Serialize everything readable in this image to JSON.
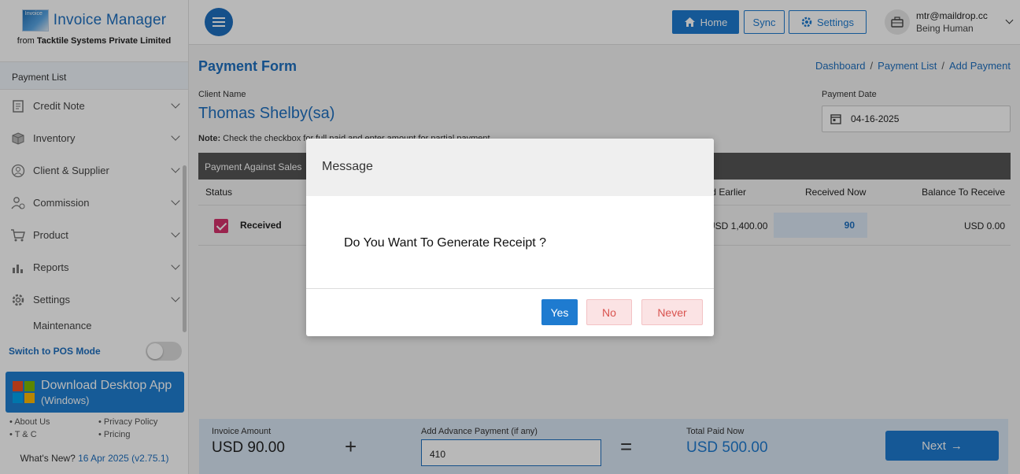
{
  "brand": {
    "logo_text": "Invoice",
    "title": "Invoice Manager",
    "subtitle_prefix": "from ",
    "subtitle_company": "Tacktile Systems Private Limited"
  },
  "sidebar": {
    "active_link": "Payment List",
    "items": [
      {
        "label": "Credit Note",
        "icon": "credit-note-icon"
      },
      {
        "label": "Inventory",
        "icon": "box-icon"
      },
      {
        "label": "Client & Supplier",
        "icon": "user-icon"
      },
      {
        "label": "Commission",
        "icon": "users-icon"
      },
      {
        "label": "Product",
        "icon": "cart-icon"
      },
      {
        "label": "Reports",
        "icon": "report-icon"
      },
      {
        "label": "Settings",
        "icon": "gear-icon"
      },
      {
        "label": "Maintenance",
        "icon": "wrench-icon"
      }
    ],
    "pos_mode_label": "Switch to POS Mode",
    "pos_mode_enabled": false,
    "download": {
      "title": "Download Desktop App",
      "subtitle": "(Windows)"
    },
    "footer_links": [
      "About Us",
      "Privacy Policy",
      "T & C",
      "Pricing"
    ],
    "whats_new_label": "What's New? ",
    "whats_new_version": "16 Apr 2025 (v2.75.1)"
  },
  "topbar": {
    "home": "Home",
    "sync": "Sync",
    "settings": "Settings",
    "user_email": "mtr@maildrop.cc",
    "user_subtitle": "Being Human"
  },
  "page": {
    "title": "Payment Form",
    "breadcrumb": [
      "Dashboard",
      "Payment List",
      "Add Payment"
    ],
    "client_label": "Client Name",
    "client_name": "Thomas Shelby(sa)",
    "date_label": "Payment Date",
    "date_value": "04-16-2025",
    "note_bold": "Note:",
    "note_text": " Check the checkbox for full paid and enter amount for partial payment",
    "table_title": "Payment Against Sales",
    "columns": {
      "status": "Status",
      "received_earlier": "Received Earlier",
      "received_now": "Received Now",
      "balance": "Balance To Receive"
    },
    "row": {
      "status": "Received",
      "received_earlier": "USD 1,400.00",
      "received_now": "90",
      "balance": "USD 0.00"
    }
  },
  "summary": {
    "invoice_label": "Invoice Amount",
    "invoice_amount": "USD 90.00",
    "plus": "+",
    "advance_label": "Add Advance Payment (if any)",
    "advance_value": "410",
    "equals": "=",
    "total_label": "Total Paid Now",
    "total_amount": "USD 500.00",
    "next": "Next"
  },
  "modal": {
    "title": "Message",
    "message": "Do You Want To Generate Receipt ?",
    "yes": "Yes",
    "no": "No",
    "never": "Never"
  },
  "colors": {
    "primary": "#1e7bd0",
    "danger": "#d9534f",
    "check": "#d6336c"
  }
}
